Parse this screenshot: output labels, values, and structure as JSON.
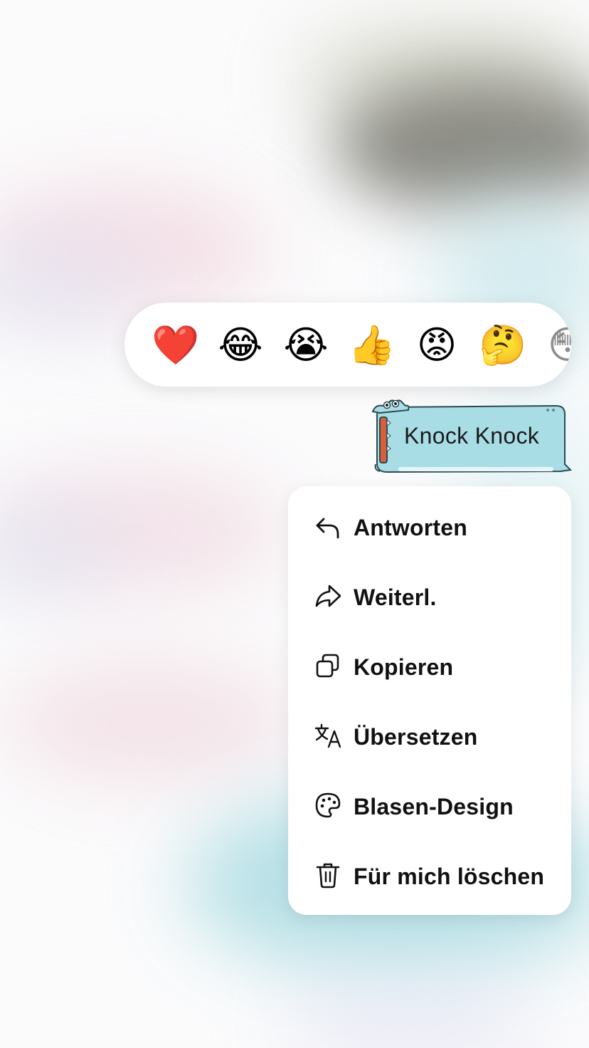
{
  "reactions": [
    {
      "emoji": "❤️",
      "name": "red-heart"
    },
    {
      "emoji": "😂",
      "name": "face-with-tears-of-joy"
    },
    {
      "emoji": "😭",
      "name": "loudly-crying-face"
    },
    {
      "emoji": "👍",
      "name": "thumbs-up"
    },
    {
      "emoji": "😡",
      "name": "pouting-face"
    },
    {
      "emoji": "🤔",
      "name": "thinking-face"
    },
    {
      "emoji": "😳",
      "name": "flushed-face"
    }
  ],
  "message": {
    "text": "Knock Knock",
    "bubble_color": "#a9dde6",
    "accent_color": "#d95f3b"
  },
  "menu": {
    "items": [
      {
        "label": "Antworten",
        "icon": "reply-icon"
      },
      {
        "label": "Weiterl.",
        "icon": "forward-icon"
      },
      {
        "label": "Kopieren",
        "icon": "copy-icon"
      },
      {
        "label": "Übersetzen",
        "icon": "translate-icon"
      },
      {
        "label": "Blasen-Design",
        "icon": "palette-icon"
      },
      {
        "label": "Für mich löschen",
        "icon": "trash-icon"
      }
    ]
  }
}
